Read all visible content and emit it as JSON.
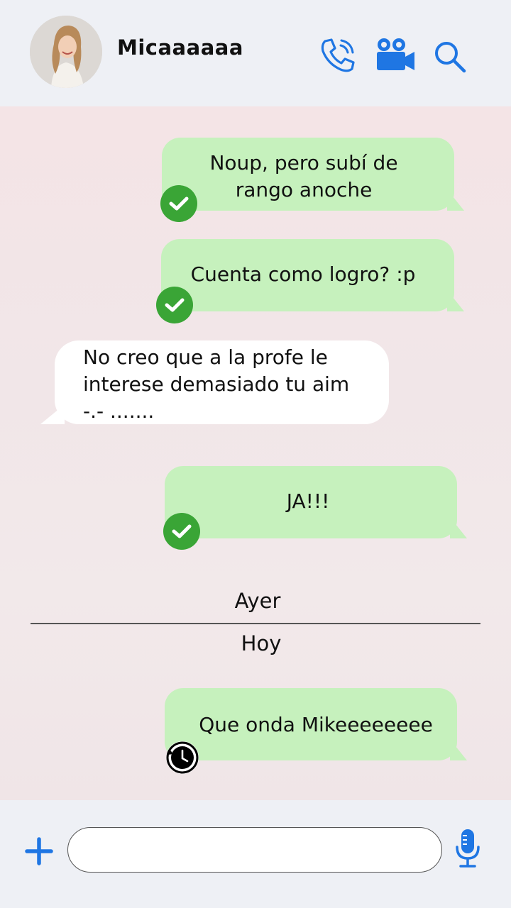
{
  "header": {
    "contact_name": "Micaaaaaa",
    "icons": [
      "avatar",
      "phone-call-icon",
      "video-camera-icon",
      "search-icon"
    ],
    "accent_color": "#1f76e3"
  },
  "messages": [
    {
      "direction": "outgoing",
      "lines": [
        "Noup, pero subí de",
        "rango anoche"
      ],
      "status": "sent-check"
    },
    {
      "direction": "outgoing",
      "lines": [
        "Cuenta como logro? :p"
      ],
      "status": "sent-check"
    },
    {
      "direction": "incoming",
      "lines": [
        "No creo que a la profe le",
        "interese demasiado tu aim",
        "-.- ......."
      ]
    },
    {
      "direction": "outgoing",
      "lines": [
        "JA!!!"
      ],
      "status": "sent-check"
    },
    {
      "direction": "outgoing",
      "lines": [
        "Que onda Mikeeeeeeee"
      ],
      "status": "pending-clock"
    }
  ],
  "dividers": {
    "previous": "Ayer",
    "current": "Hoy"
  },
  "composer": {
    "value": "",
    "placeholder": ""
  },
  "colors": {
    "outgoing_bubble": "#c6f1bd",
    "incoming_bubble": "#ffffff",
    "check_badge": "#3aa536",
    "chat_background": "#f3e6e8",
    "bar_background": "#eef0f5"
  }
}
